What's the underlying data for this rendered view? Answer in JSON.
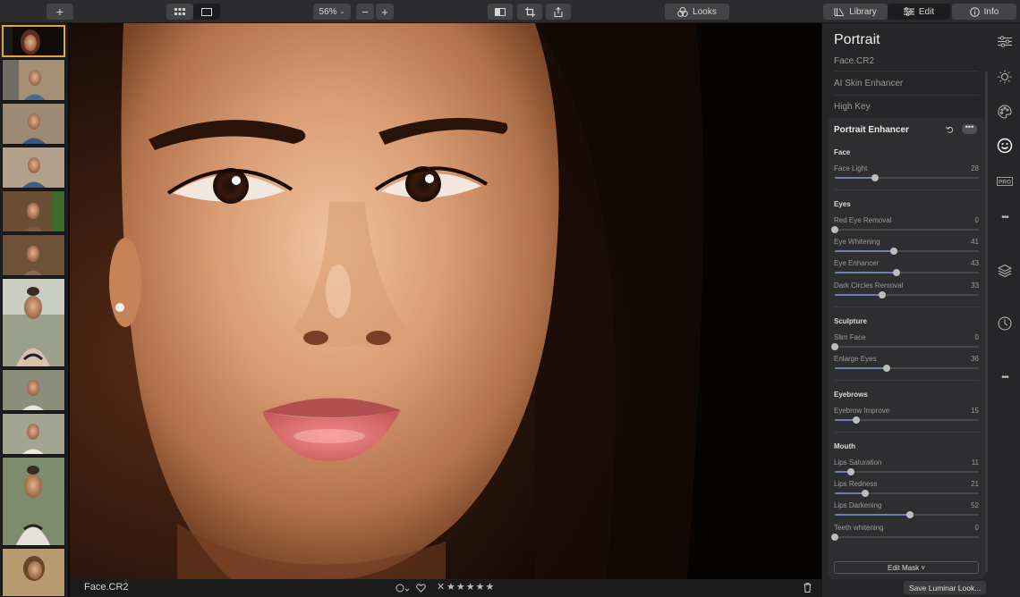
{
  "toolbar": {
    "add_label": "+",
    "zoom": "56%",
    "zoom_out_label": "−",
    "zoom_in_label": "+",
    "looks_label": "Looks",
    "modes": [
      {
        "label": "Library",
        "icon": "library-icon"
      },
      {
        "label": "Edit",
        "icon": "sliders-icon",
        "active": true
      },
      {
        "label": "Info",
        "icon": "info-icon"
      }
    ]
  },
  "viewer": {
    "filename": "Face.CR2"
  },
  "panel": {
    "title": "Portrait",
    "filename": "Face.CR2",
    "tools": [
      "AI Skin Enhancer",
      "High Key"
    ],
    "module_title": "Portrait Enhancer",
    "sections": [
      {
        "name": "Face",
        "sliders": [
          {
            "label": "Face Light",
            "value": 28
          }
        ]
      },
      {
        "name": "Eyes",
        "sliders": [
          {
            "label": "Red Eye Removal",
            "value": 0
          },
          {
            "label": "Eye Whitening",
            "value": 41
          },
          {
            "label": "Eye Enhancer",
            "value": 43
          },
          {
            "label": "Dark Circles Removal",
            "value": 33
          }
        ]
      },
      {
        "name": "Sculpture",
        "sliders": [
          {
            "label": "Slim Face",
            "value": 0
          },
          {
            "label": "Enlarge Eyes",
            "value": 36
          }
        ]
      },
      {
        "name": "Eyebrows",
        "sliders": [
          {
            "label": "Eyebrow Improve",
            "value": 15
          }
        ]
      },
      {
        "name": "Mouth",
        "sliders": [
          {
            "label": "Lips Saturation",
            "value": 11
          },
          {
            "label": "Lips Redness",
            "value": 21
          },
          {
            "label": "Lips Darkening",
            "value": 52
          },
          {
            "label": "Teeth whitening",
            "value": 0
          }
        ]
      }
    ],
    "edit_mask_label": "Edit Mask ˅",
    "save_look_label": "Save Luminar Look..."
  },
  "colors": {
    "accent_selected": "#e8a33b",
    "slider_fill": "#6f7fb0",
    "panel_bg": "#262628"
  },
  "rail_icons": [
    "adjust-icon",
    "sun-icon",
    "palette-icon",
    "face-icon",
    "pro-icon",
    "more-icon",
    "layers-icon",
    "history-icon",
    "more-icon"
  ]
}
